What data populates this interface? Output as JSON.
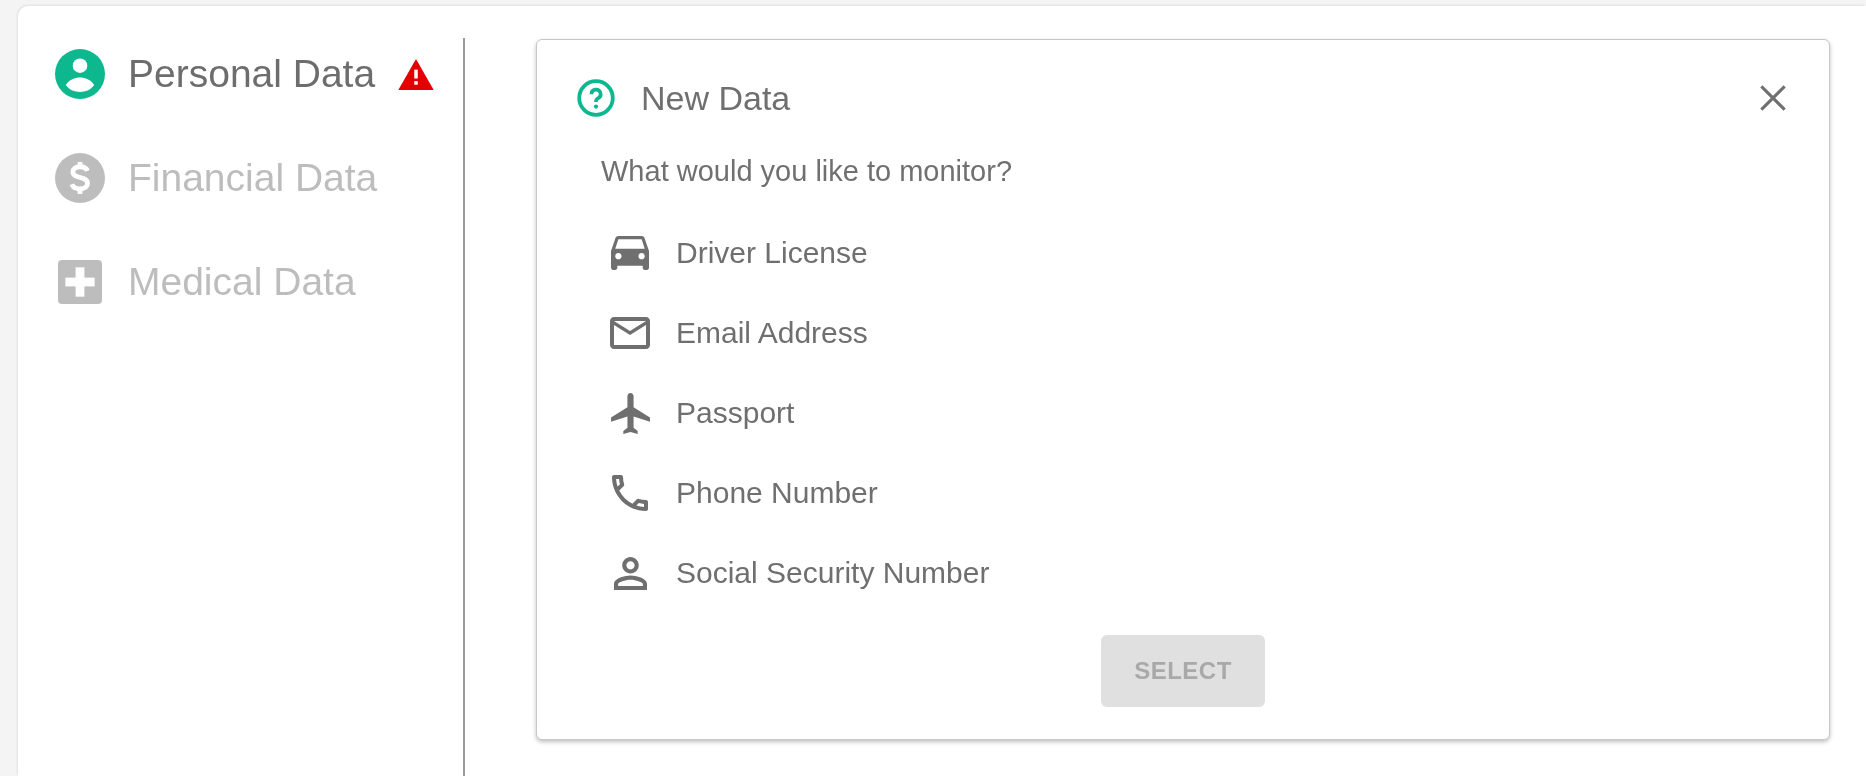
{
  "sidebar": {
    "items": [
      {
        "label": "Personal Data",
        "selected": true,
        "alert": true
      },
      {
        "label": "Financial Data",
        "selected": false,
        "alert": false
      },
      {
        "label": "Medical Data",
        "selected": false,
        "alert": false
      }
    ]
  },
  "dialog": {
    "title": "New Data",
    "prompt": "What would you like to monitor?",
    "options": [
      {
        "label": "Driver License",
        "selected": false
      },
      {
        "label": "Email Address",
        "selected": false
      },
      {
        "label": "Passport",
        "selected": false
      },
      {
        "label": "Phone Number",
        "selected": false
      },
      {
        "label": "Social Security Number",
        "selected": false
      }
    ],
    "select_button": {
      "label": "SELECT",
      "disabled": true
    }
  }
}
